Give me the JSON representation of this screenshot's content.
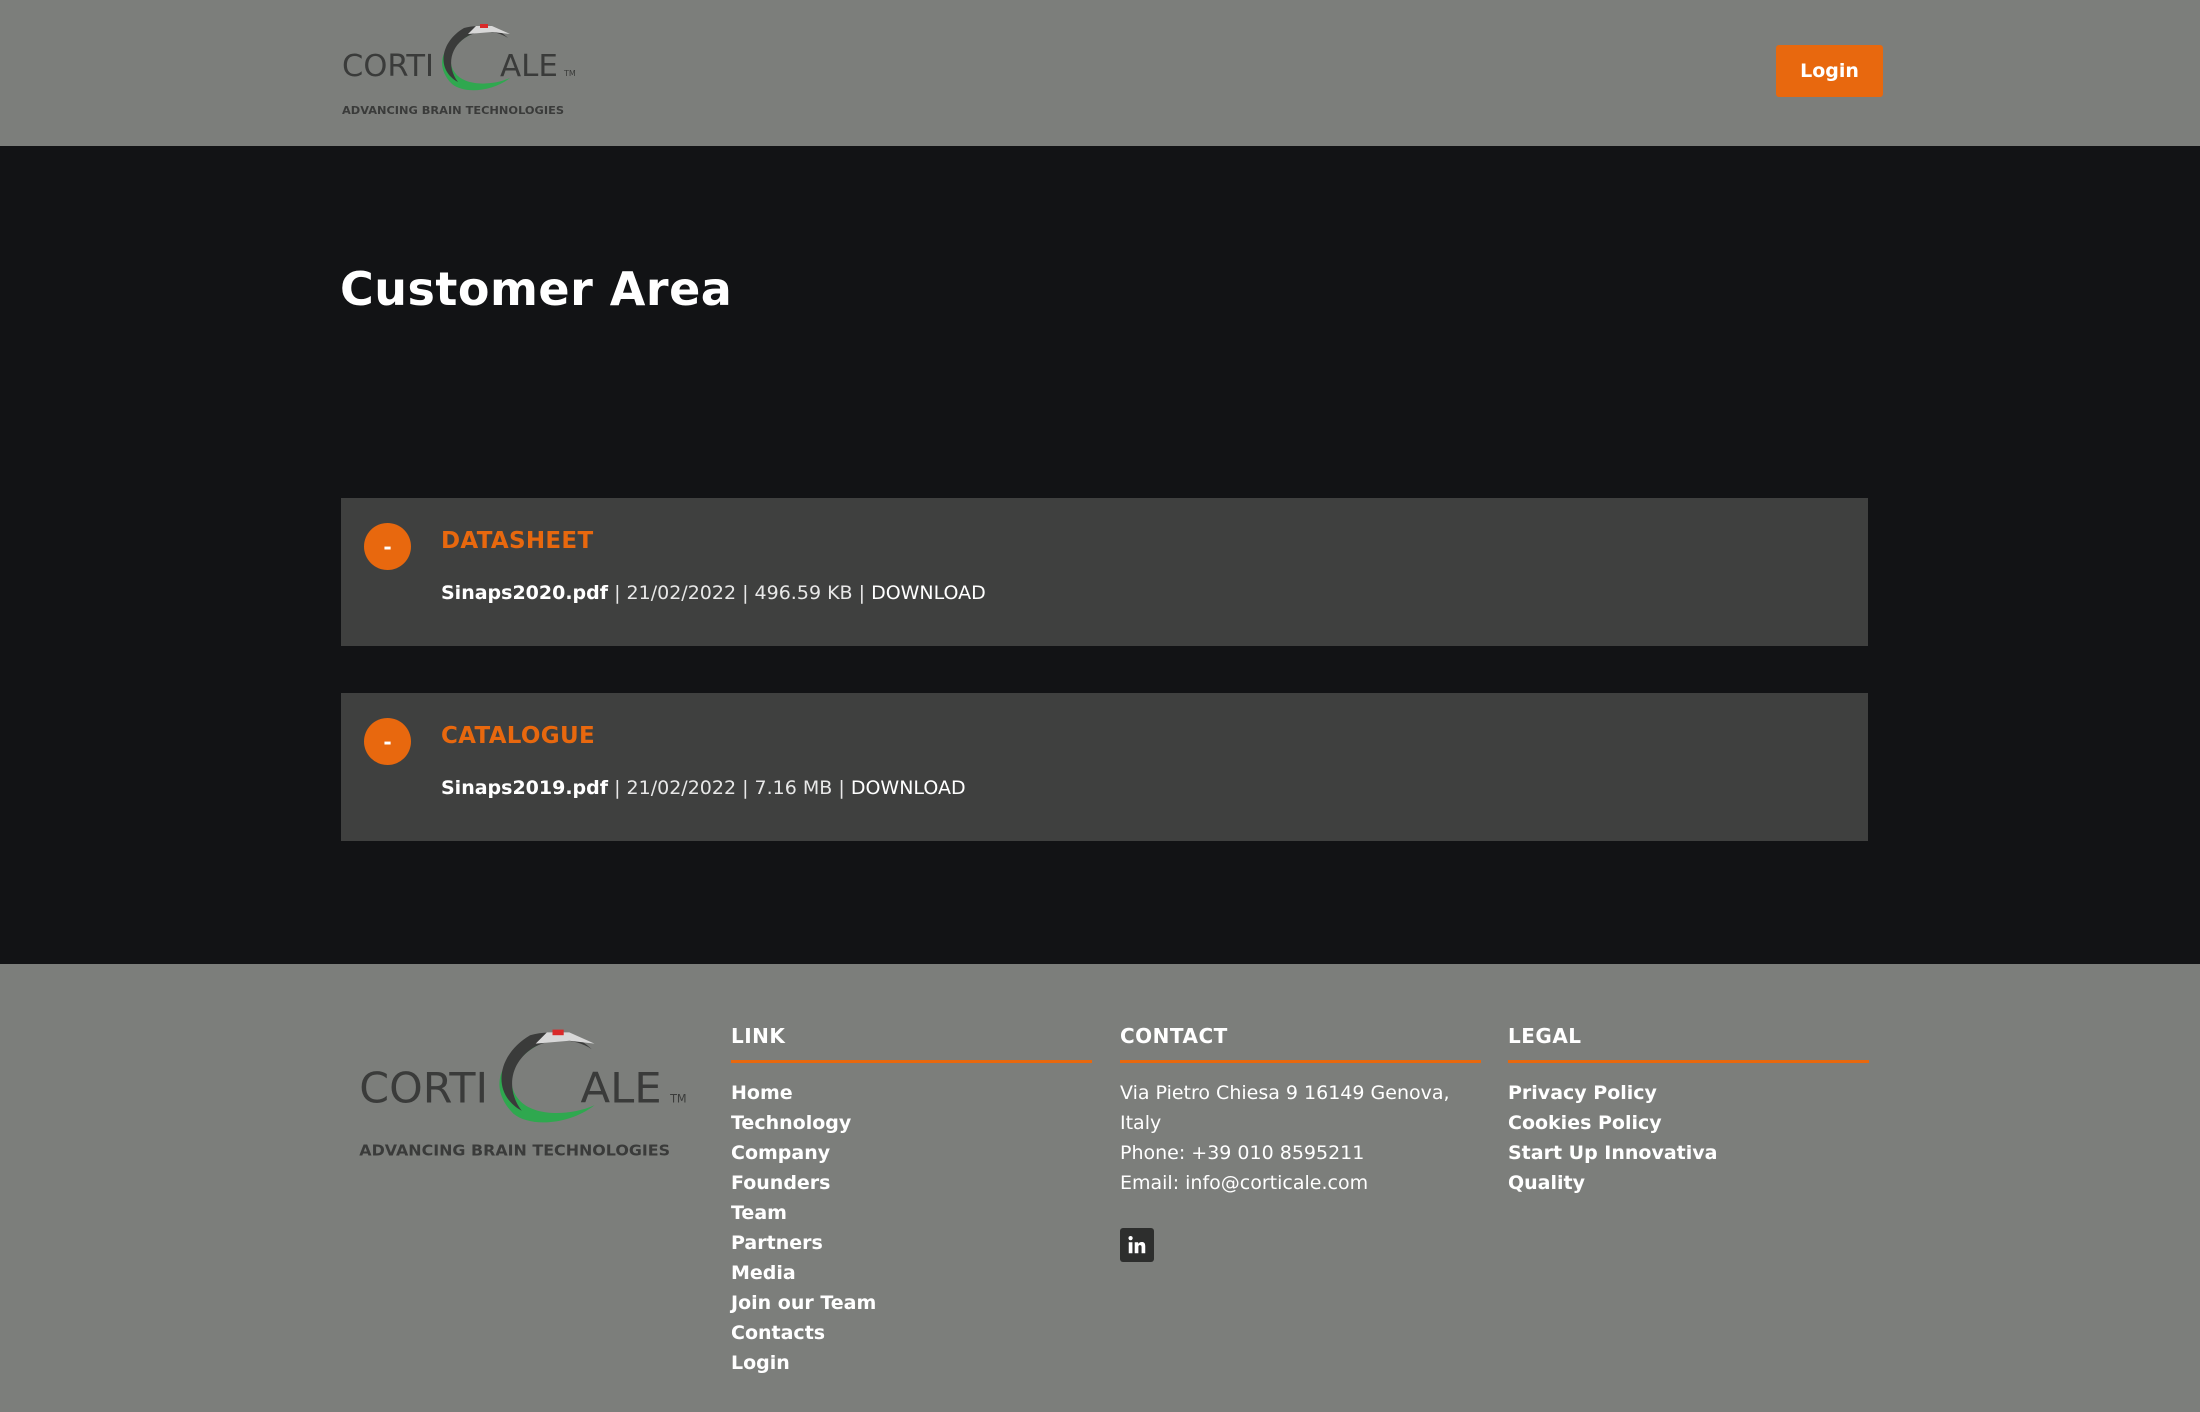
{
  "header": {
    "login_label": "Login"
  },
  "logo": {
    "text_left": "CORTI",
    "text_right": "ALE",
    "trademark": "TM",
    "tagline": "ADVANCING BRAIN TECHNOLOGIES"
  },
  "main": {
    "title": "Customer Area",
    "sections": [
      {
        "toggle": "-",
        "title": "DATASHEET",
        "file_name": "Sinaps2020.pdf",
        "date": "21/02/2022",
        "size": "496.59 KB",
        "download": "DOWNLOAD"
      },
      {
        "toggle": "-",
        "title": "CATALOGUE",
        "file_name": "Sinaps2019.pdf",
        "date": "21/02/2022",
        "size": "7.16 MB",
        "download": "DOWNLOAD"
      }
    ],
    "separator": "|"
  },
  "footer": {
    "link": {
      "heading": "LINK",
      "items": [
        "Home",
        "Technology",
        "Company",
        "Founders",
        "Team",
        "Partners",
        "Media",
        "Join our Team",
        "Contacts",
        "Login"
      ]
    },
    "contact": {
      "heading": "CONTACT",
      "address": "Via Pietro Chiesa 9 16149 Genova, Italy",
      "phone": "Phone: +39 010 8595211",
      "email": "Email: info@corticale.com",
      "social_icon": "linkedin-icon"
    },
    "legal": {
      "heading": "LEGAL",
      "items": [
        "Privacy Policy",
        "Cookies Policy",
        "Start Up Innovativa",
        "Quality"
      ]
    }
  },
  "colors": {
    "accent": "#e8680e",
    "header_bg": "#7c7e7b",
    "page_bg": "#121315",
    "panel_bg": "#3f403f",
    "logo_green": "#2fa84f",
    "logo_red": "#d92a2a",
    "logo_gray": "#3a3b3a"
  }
}
